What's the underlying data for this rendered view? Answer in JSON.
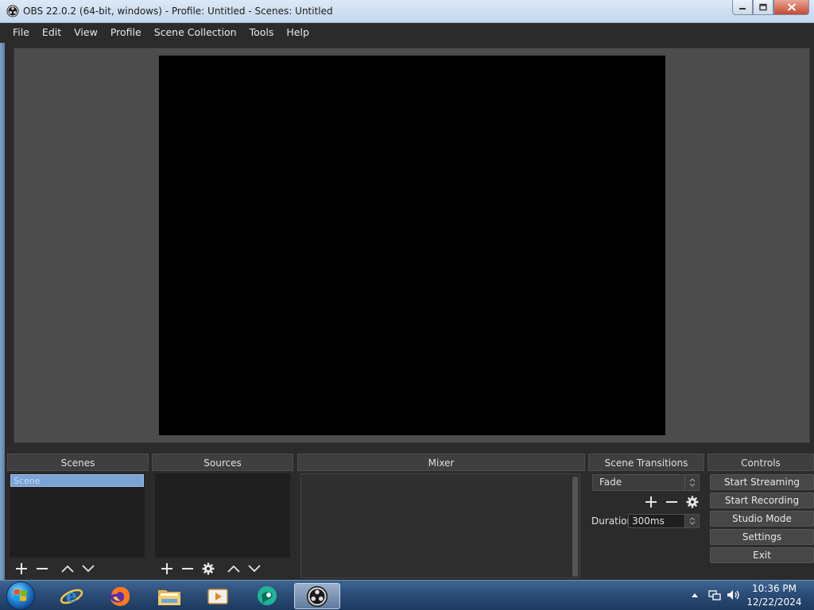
{
  "window": {
    "title": "OBS 22.0.2 (64-bit, windows) - Profile: Untitled - Scenes: Untitled"
  },
  "menu": [
    "File",
    "Edit",
    "View",
    "Profile",
    "Scene Collection",
    "Tools",
    "Help"
  ],
  "docks": {
    "scenes": {
      "title": "Scenes",
      "items": [
        "Scene"
      ]
    },
    "sources": {
      "title": "Sources"
    },
    "mixer": {
      "title": "Mixer"
    },
    "transitions": {
      "title": "Scene Transitions",
      "selected": "Fade",
      "duration_label": "Duration",
      "duration_value": "300ms"
    },
    "controls": {
      "title": "Controls",
      "buttons": [
        "Start Streaming",
        "Start Recording",
        "Studio Mode",
        "Settings",
        "Exit"
      ]
    }
  },
  "taskbar": {
    "time": "10:36 PM",
    "date": "12/22/2024",
    "icons": [
      "windows-start-icon",
      "internet-explorer-icon",
      "firefox-icon",
      "file-explorer-icon",
      "media-player-icon",
      "chat-app-icon",
      "obs-icon"
    ]
  },
  "colors": {
    "panel_bg": "#2b2b2b",
    "preview_bg": "#4c4c4c",
    "selection": "#7aa3d6"
  }
}
